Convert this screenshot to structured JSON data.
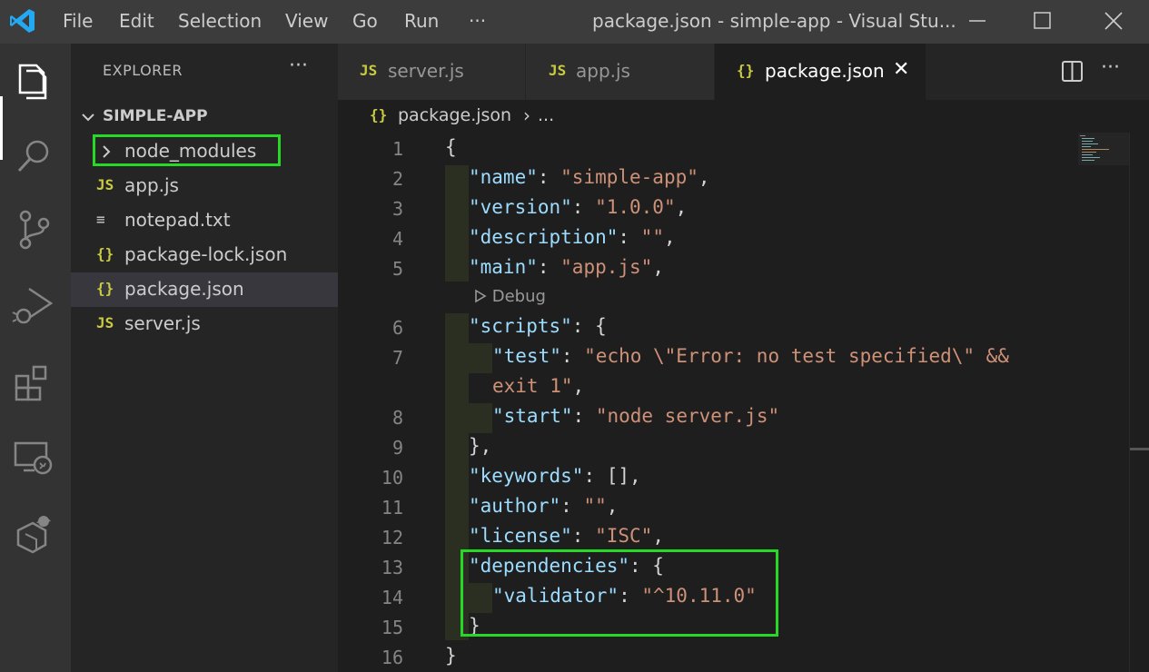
{
  "titlebar": {
    "menu": [
      "File",
      "Edit",
      "Selection",
      "View",
      "Go",
      "Run",
      "···"
    ],
    "title": "package.json - simple-app - Visual Stu..."
  },
  "activity_bar": {
    "icons": [
      "files-icon",
      "search-icon",
      "source-control-icon",
      "run-debug-icon",
      "extensions-icon",
      "remote-explorer-icon",
      "docker-icon"
    ]
  },
  "sidebar": {
    "title": "EXPLORER",
    "more": "···",
    "folder": "SIMPLE-APP",
    "items": [
      {
        "icon": "",
        "label": "node_modules"
      },
      {
        "icon": "JS",
        "label": "app.js"
      },
      {
        "icon": "≡",
        "label": "notepad.txt"
      },
      {
        "icon": "{}",
        "label": "package-lock.json"
      },
      {
        "icon": "{}",
        "label": "package.json"
      },
      {
        "icon": "JS",
        "label": "server.js"
      }
    ]
  },
  "tabs": [
    {
      "icon": "JS",
      "label": "server.js"
    },
    {
      "icon": "JS",
      "label": "app.js"
    },
    {
      "icon": "{}",
      "label": "package.json",
      "close": "✕"
    }
  ],
  "breadcrumb": {
    "icon": "{}",
    "file": "package.json",
    "sep": "›",
    "more": "..."
  },
  "codelens": "Debug",
  "editor": {
    "line_numbers": [
      "1",
      "2",
      "3",
      "4",
      "5",
      "6",
      "7",
      "8",
      "9",
      "10",
      "11",
      "12",
      "13",
      "14",
      "15",
      "16"
    ],
    "lines": {
      "l1": "{",
      "name_key": "\"name\"",
      "name_val": "\"simple-app\"",
      "version_key": "\"version\"",
      "version_val": "\"1.0.0\"",
      "desc_key": "\"description\"",
      "desc_val": "\"\"",
      "main_key": "\"main\"",
      "main_val": "\"app.js\"",
      "scripts_key": "\"scripts\"",
      "test_key": "\"test\"",
      "test_val_1": "\"echo \\\"Error: no test specified\\\" &&",
      "test_val_2": "exit 1\"",
      "start_key": "\"start\"",
      "start_val": "\"node server.js\"",
      "close_scripts": "},",
      "keywords_key": "\"keywords\"",
      "keywords_val": "[],",
      "author_key": "\"author\"",
      "author_val": "\"\"",
      "license_key": "\"license\"",
      "license_val": "\"ISC\"",
      "deps_key": "\"dependencies\"",
      "validator_key": "\"validator\"",
      "validator_val": "\"^10.11.0\"",
      "close_deps": "}",
      "l16": "}"
    }
  }
}
